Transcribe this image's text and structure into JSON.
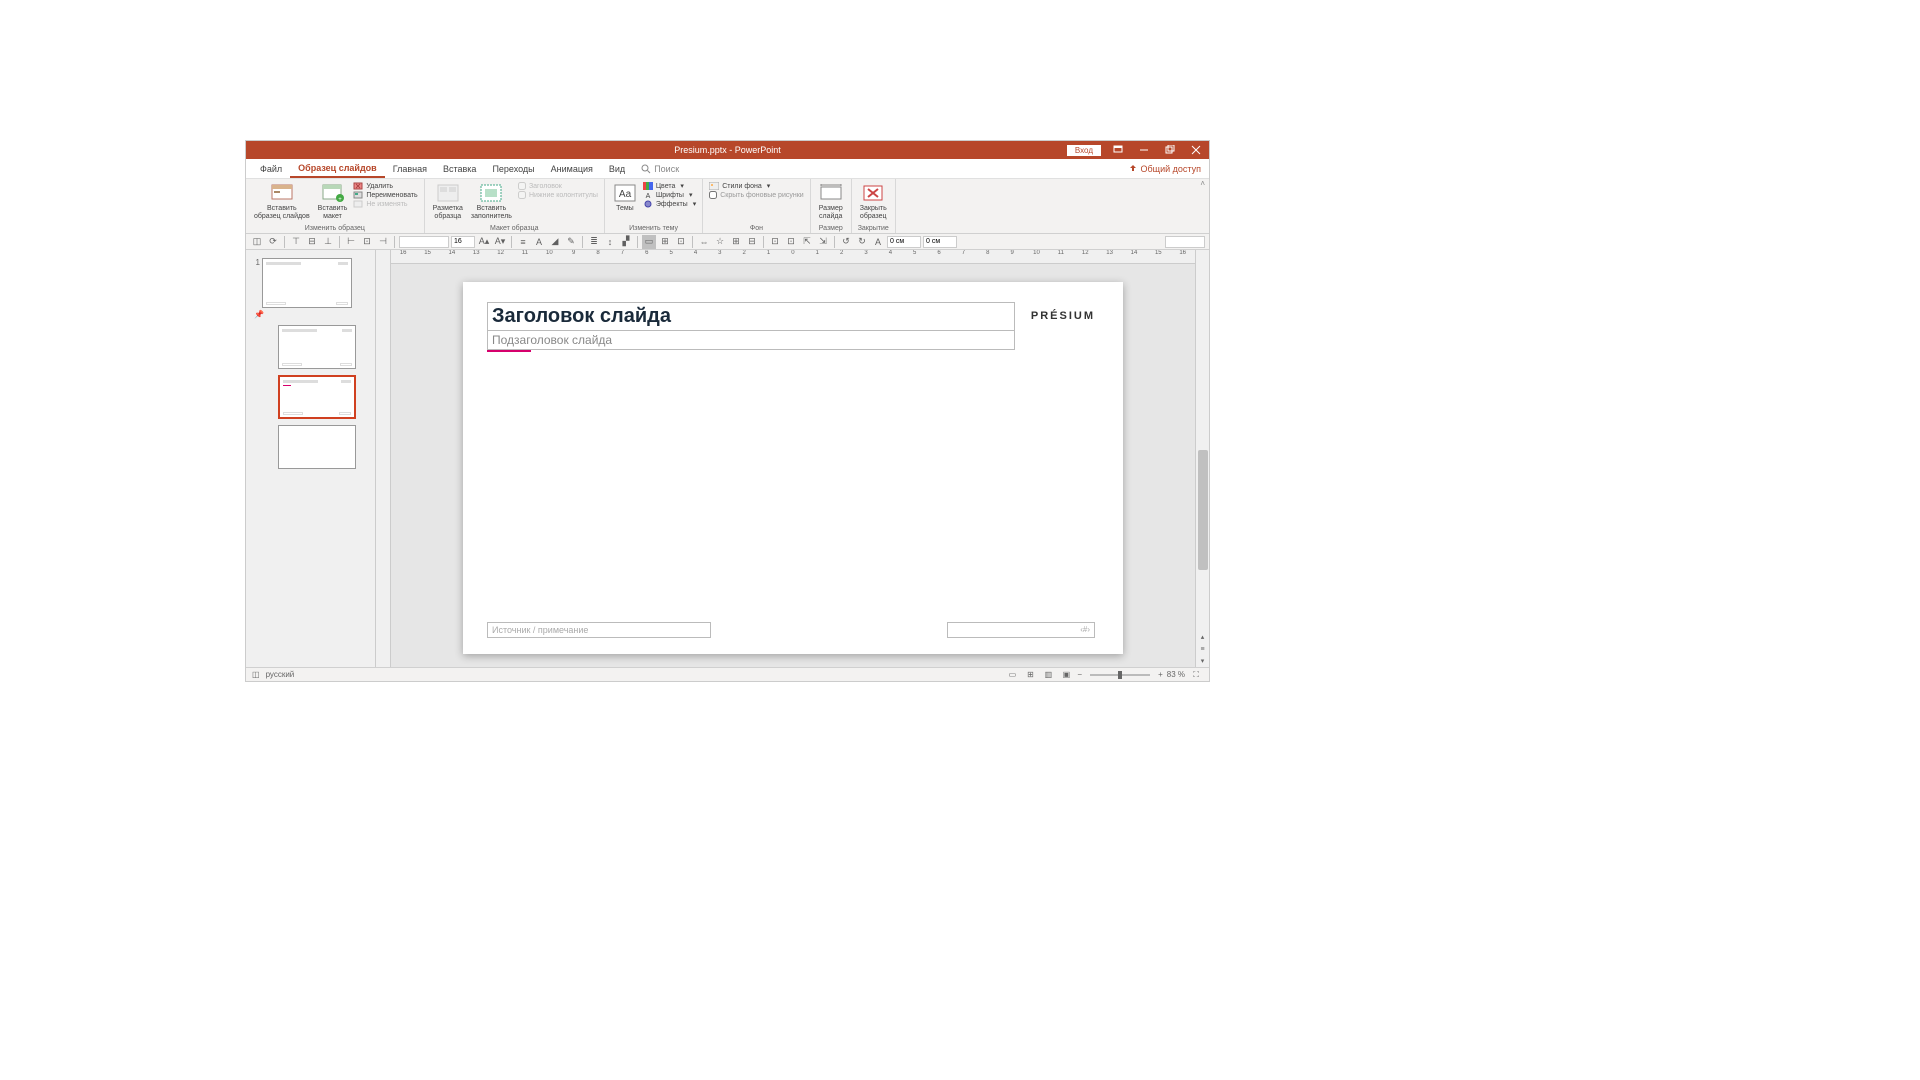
{
  "titlebar": {
    "title": "Presium.pptx - PowerPoint",
    "login": "Вход"
  },
  "menu": {
    "file": "Файл",
    "slide_master": "Образец слайдов",
    "home": "Главная",
    "insert": "Вставка",
    "transitions": "Переходы",
    "animation": "Анимация",
    "view": "Вид",
    "search_placeholder": "Поиск",
    "share": "Общий доступ"
  },
  "ribbon": {
    "group1": {
      "insert_slide_master": "Вставить\nобразец слайдов",
      "insert_layout": "Вставить\nмакет",
      "delete": "Удалить",
      "rename": "Переименовать",
      "preserve": "Не изменять",
      "label": "Изменить образец"
    },
    "group2": {
      "master_layout": "Разметка\nобразца",
      "insert_placeholder": "Вставить\nзаполнитель",
      "title_chk": "Заголовок",
      "footers_chk": "Нижние колонтитулы",
      "label": "Макет образца"
    },
    "group3": {
      "themes": "Темы",
      "colors": "Цвета",
      "fonts": "Шрифты",
      "effects": "Эффекты",
      "label": "Изменить тему"
    },
    "group4": {
      "bg_styles": "Стили фона",
      "hide_bg": "Скрыть фоновые рисунки",
      "label": "Фон"
    },
    "group5": {
      "slide_size": "Размер\nслайда",
      "label": "Размер"
    },
    "group6": {
      "close_master": "Закрыть\nобразец",
      "label": "Закрытие"
    }
  },
  "qat": {
    "font_size": "16",
    "pos_x": "0 см",
    "pos_y": "0 см"
  },
  "thumbnails": {
    "master_num": "1"
  },
  "slide": {
    "title": "Заголовок слайда",
    "subtitle": "Подзаголовок слайда",
    "logo": "PRÉSIUM",
    "footer_left": "Источник / примечание",
    "footer_right": "‹#›"
  },
  "statusbar": {
    "lang": "русский",
    "zoom": "83 %"
  },
  "ruler_h": [
    "16",
    "15",
    "14",
    "13",
    "12",
    "11",
    "10",
    "9",
    "8",
    "7",
    "6",
    "5",
    "4",
    "3",
    "2",
    "1",
    "0",
    "1",
    "2",
    "3",
    "4",
    "5",
    "6",
    "7",
    "8",
    "9",
    "10",
    "11",
    "12",
    "13",
    "14",
    "15",
    "16"
  ]
}
